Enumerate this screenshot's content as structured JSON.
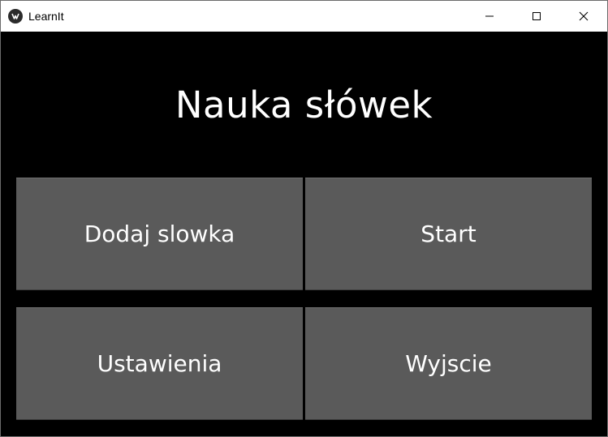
{
  "window": {
    "title": "LearnIt",
    "icons": {
      "app": "app-logo-icon",
      "minimize": "minimize-icon",
      "maximize": "maximize-icon",
      "close": "close-icon"
    }
  },
  "main": {
    "heading": "Nauka słówek",
    "buttons": [
      {
        "label": "Dodaj slowka"
      },
      {
        "label": "Start"
      },
      {
        "label": "Ustawienia"
      },
      {
        "label": "Wyjscie"
      }
    ]
  },
  "colors": {
    "background": "#000000",
    "button_bg": "#5a5a5a",
    "text": "#ffffff",
    "titlebar_bg": "#ffffff"
  }
}
